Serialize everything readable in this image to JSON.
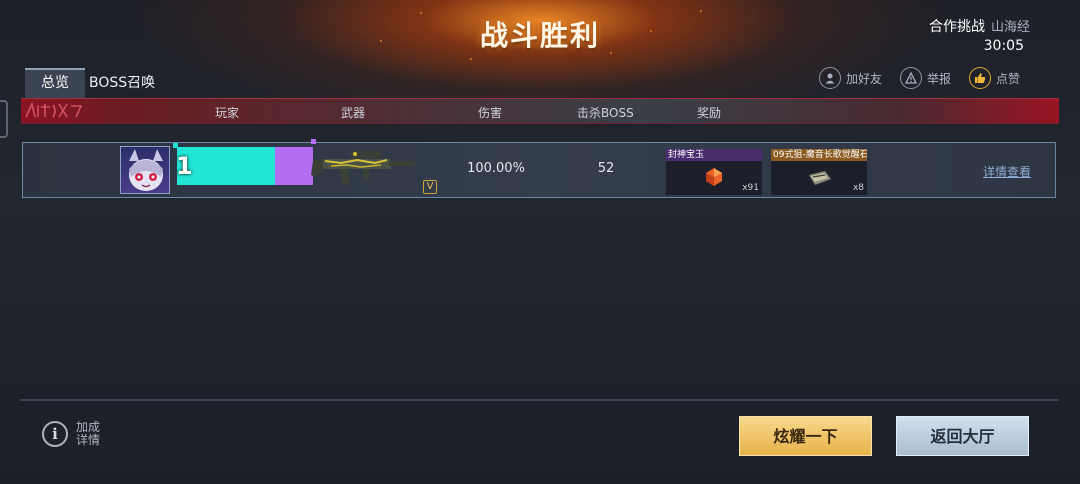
{
  "header": {
    "title": "战斗胜利",
    "mode": "合作挑战",
    "map": "山海经",
    "timer": "30:05"
  },
  "tabs": [
    {
      "label": "总览",
      "active": true
    },
    {
      "label": "BOSS召唤",
      "active": false
    }
  ],
  "actions": [
    {
      "label": "加好友",
      "icon": "add-friend-icon"
    },
    {
      "label": "举报",
      "icon": "report-icon"
    },
    {
      "label": "点赞",
      "icon": "thumbs-up-icon"
    }
  ],
  "columns": {
    "player": "玩家",
    "weapon": "武器",
    "damage": "伤害",
    "kills": "击杀BOSS",
    "reward": "奖励"
  },
  "player_row": {
    "rank": "1",
    "weapon_badge": "V",
    "damage": "100.00%",
    "boss_kills": "52",
    "rewards": [
      {
        "name": "封神宝玉",
        "count": "x91",
        "icon": "gem-icon"
      },
      {
        "name": "09式狙-魔音长歌觉醒石",
        "count": "x8",
        "icon": "awakening-stone-icon"
      }
    ],
    "detail_link": "详情查看"
  },
  "footer": {
    "info_line1": "加成",
    "info_line2": "详情",
    "show_off_button": "炫耀一下",
    "back_button": "返回大厅"
  },
  "colors": {
    "accent_gold": "#e8b34a",
    "header_red": "#8a1420",
    "name_teal": "#22e4d4",
    "name_purple": "#b36cf2"
  }
}
